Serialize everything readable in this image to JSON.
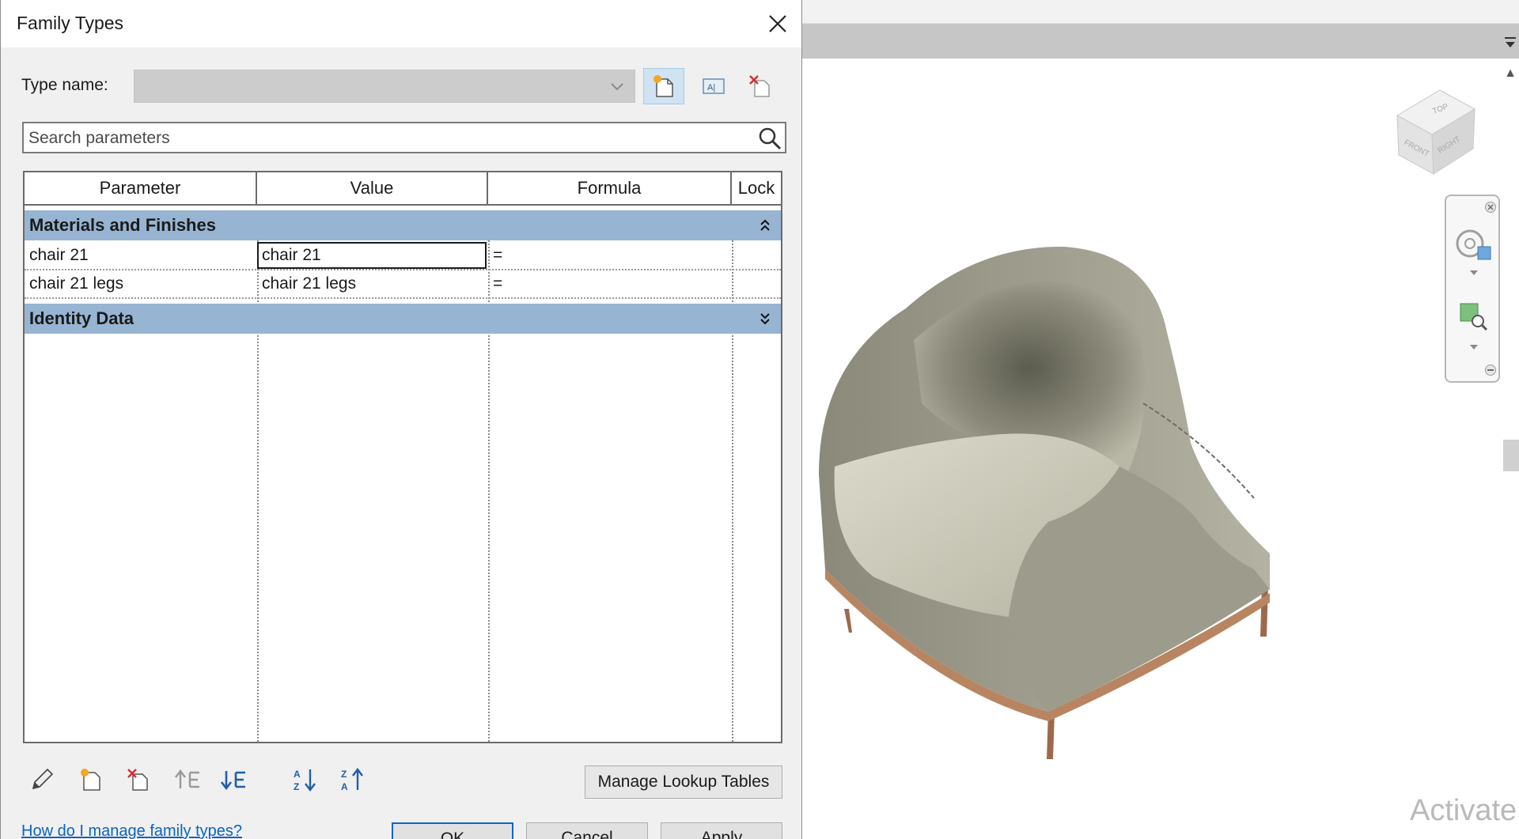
{
  "dialog": {
    "title": "Family Types",
    "type_name_label": "Type name:",
    "type_name_value": "",
    "search": {
      "placeholder": "Search parameters"
    },
    "columns": [
      "Parameter",
      "Value",
      "Formula",
      "Lock"
    ],
    "groups": [
      {
        "name": "Materials and Finishes",
        "expanded": true,
        "rows": [
          {
            "parameter": "chair 21",
            "value": "chair 21",
            "formula": "=",
            "lock": ""
          },
          {
            "parameter": "chair 21 legs",
            "value": "chair 21 legs",
            "formula": "=",
            "lock": ""
          }
        ]
      },
      {
        "name": "Identity Data",
        "expanded": false,
        "rows": []
      }
    ],
    "manage_lookup_label": "Manage Lookup Tables",
    "help_link": "How do I manage family types?",
    "ok_label": "OK",
    "cancel_label": "Cancel",
    "apply_label": "Apply"
  },
  "viewport": {
    "viewcube_faces": [
      "TOP",
      "FRONT",
      "RIGHT"
    ],
    "watermark": "Activate"
  },
  "colors": {
    "group_header": "#97b4d2",
    "selected_toolbar_button": "#cfe3f3",
    "link": "#0b63c4",
    "delete_red": "#d32f2f"
  }
}
